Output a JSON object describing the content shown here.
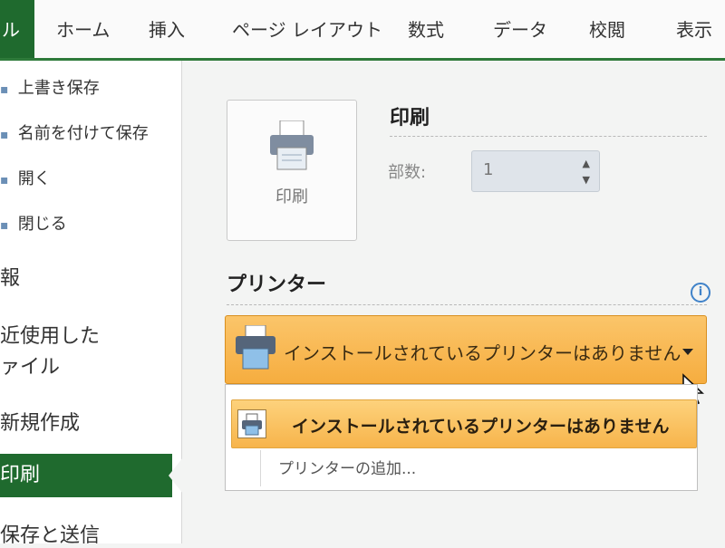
{
  "ribbon": {
    "tabs": [
      "ル",
      "ホーム",
      "挿入",
      "ページ レイアウト",
      "数式",
      "データ",
      "校閲",
      "表示"
    ]
  },
  "nav": {
    "save": "上書き保存",
    "save_as": "名前を付けて保存",
    "open": "開く",
    "close": "閉じる",
    "info": "報",
    "recent_line1": "近使用した",
    "recent_line2": "ァイル",
    "new": "新規作成",
    "print": "印刷",
    "send": "保存と送信"
  },
  "print": {
    "tile_label": "印刷",
    "title": "印刷",
    "copies_label": "部数:",
    "copies_value": "1"
  },
  "printer": {
    "heading": "プリンター",
    "info_glyph": "i",
    "selected": "インストールされているプリンターはありません",
    "options": [
      "インストールされているプリンターはありません",
      "プリンターの追加..."
    ]
  },
  "colors": {
    "accent_green": "#1f6a2e",
    "select_orange": "#f6ad3f",
    "info_blue": "#3f82c9"
  },
  "icons": [
    "printer-icon",
    "info-icon",
    "chevron-down-icon",
    "spin-up-icon",
    "spin-down-icon",
    "folder-icon",
    "close-icon",
    "mouse-cursor-icon"
  ]
}
